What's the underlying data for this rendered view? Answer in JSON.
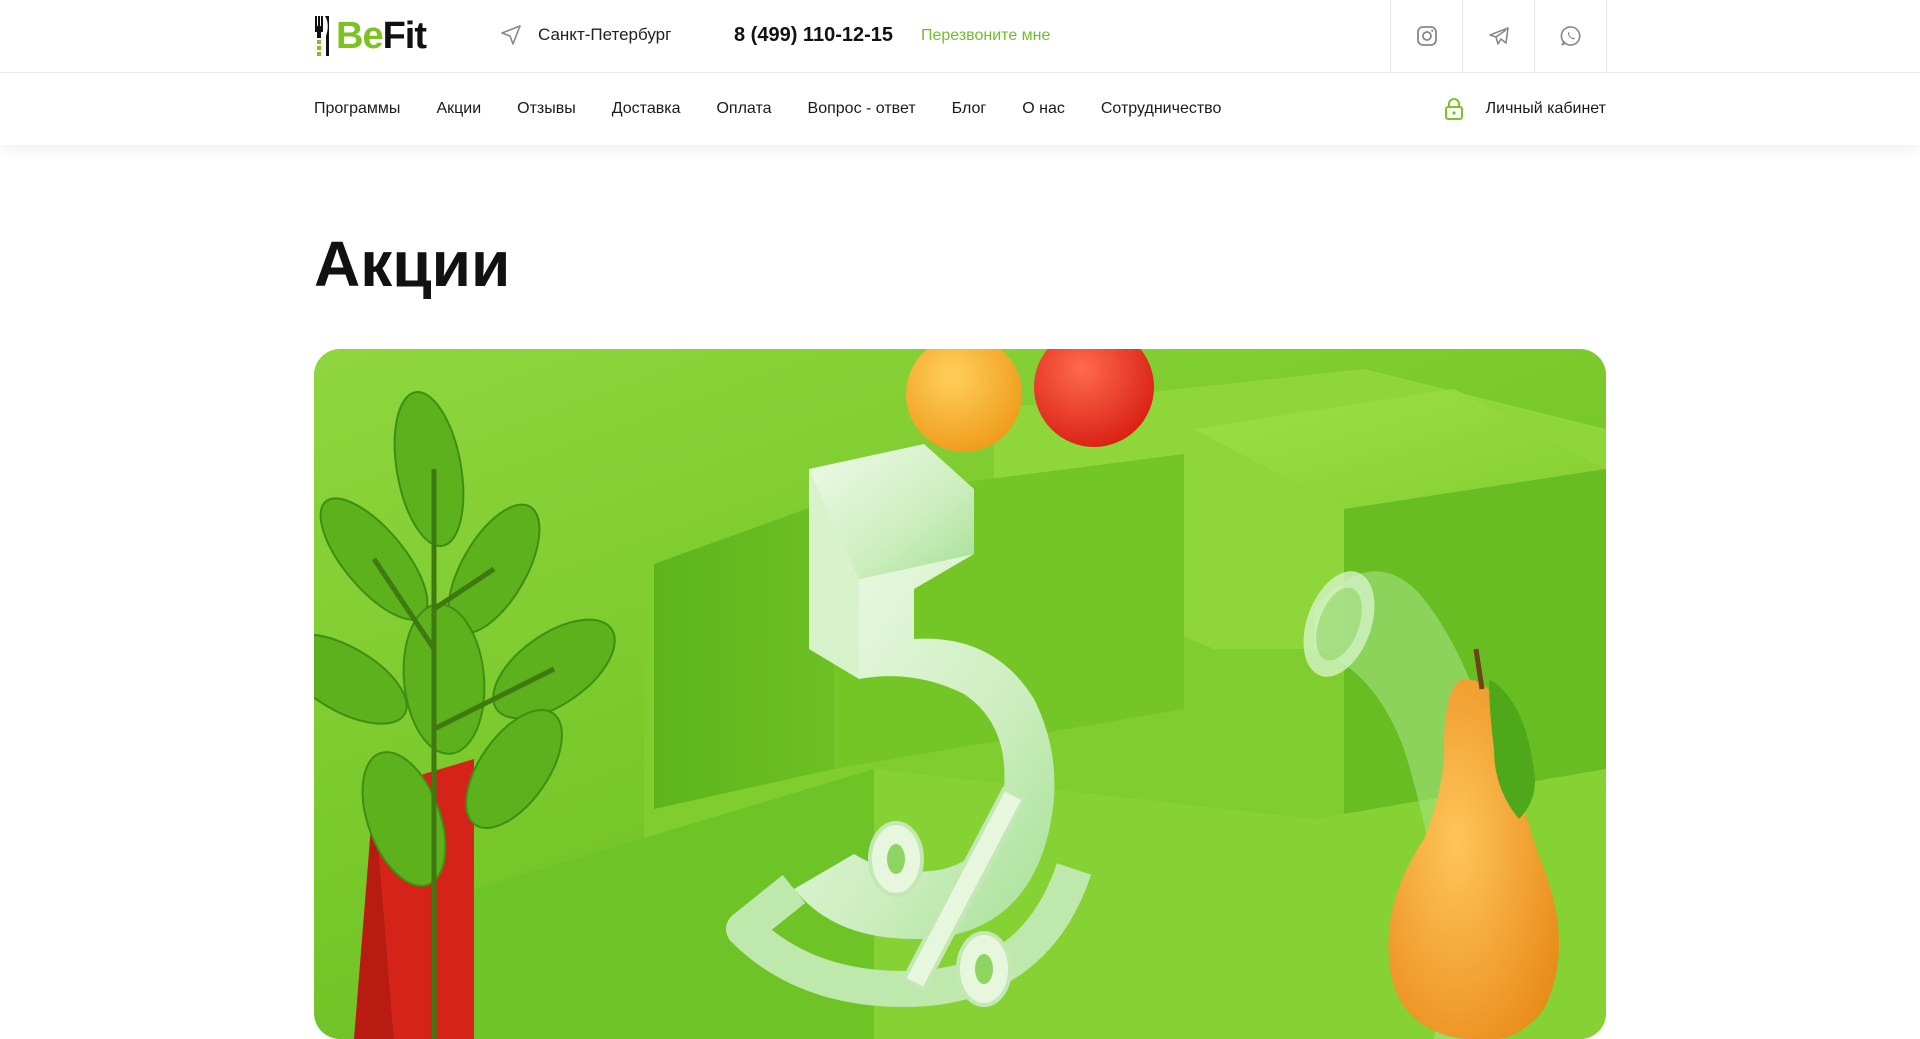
{
  "header": {
    "logo": {
      "be": "Be",
      "fit": "Fit"
    },
    "city": "Санкт-Петербург",
    "phone": "8 (499) 110-12-15",
    "callback": "Перезвоните мне",
    "socials": [
      {
        "icon": "instagram-icon"
      },
      {
        "icon": "telegram-icon"
      },
      {
        "icon": "whatsapp-icon"
      }
    ]
  },
  "nav": {
    "items": [
      "Программы",
      "Акции",
      "Отзывы",
      "Доставка",
      "Оплата",
      "Вопрос - ответ",
      "Блог",
      "О нас",
      "Сотрудничество"
    ],
    "cabinet": "Личный кабинет"
  },
  "page": {
    "title": "Акции"
  },
  "banner": {
    "big_digit": "5",
    "percent": "%",
    "colors": {
      "green": "#7cc221",
      "accent": "#6fbf2a"
    }
  }
}
